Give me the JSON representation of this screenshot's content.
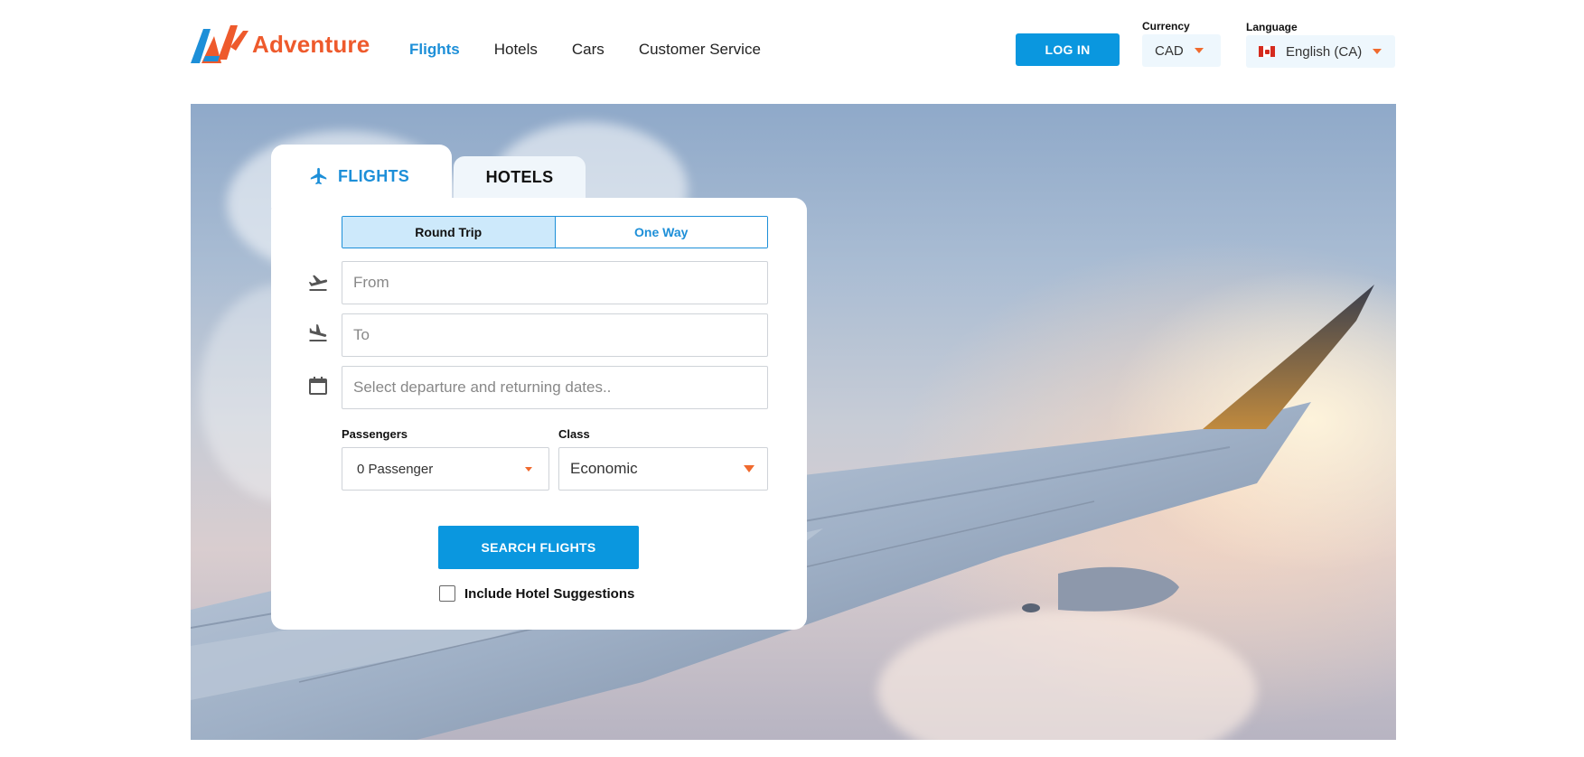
{
  "brand": {
    "name": "Adventure",
    "accent": "#ee5a2c",
    "blue": "#1d8fd8"
  },
  "nav": {
    "items": [
      {
        "label": "Flights",
        "active": true
      },
      {
        "label": "Hotels",
        "active": false
      },
      {
        "label": "Cars",
        "active": false
      },
      {
        "label": "Customer Service",
        "active": false
      }
    ]
  },
  "header": {
    "login_label": "LOG IN",
    "currency": {
      "label": "Currency",
      "value": "CAD"
    },
    "language": {
      "label": "Language",
      "value": "English (CA)",
      "flag": "canada-flag-icon"
    }
  },
  "search": {
    "tabs": {
      "flights": "FLIGHTS",
      "hotels": "HOTELS"
    },
    "trip_types": {
      "round_trip": "Round Trip",
      "one_way": "One Way",
      "selected": "Round Trip"
    },
    "from_placeholder": "From",
    "to_placeholder": "To",
    "dates_placeholder": "Select departure and returning dates..",
    "passengers": {
      "label": "Passengers",
      "value": "0 Passenger"
    },
    "class": {
      "label": "Class",
      "value": "Economic"
    },
    "submit_label": "SEARCH FLIGHTS",
    "include_hotels_label": "Include Hotel Suggestions",
    "include_hotels_checked": false
  },
  "icons": {
    "departure": "takeoff-icon",
    "arrival": "landing-icon",
    "calendar": "calendar-icon",
    "plane": "airplane-icon"
  }
}
